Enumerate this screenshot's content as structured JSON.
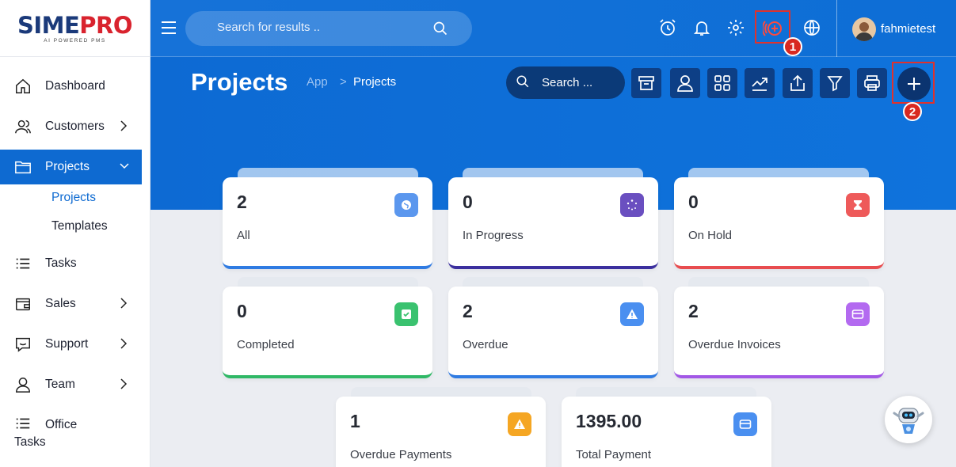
{
  "brand": {
    "name_part1": "SIME",
    "name_part2": "PRO",
    "tagline": "AI POWERED PMS"
  },
  "topbar": {
    "search_placeholder": "Search for results ..",
    "username": "fahmietest",
    "icons": [
      "alarm-clock-icon",
      "bell-icon",
      "gear-icon",
      "timer-add-icon",
      "globe-icon"
    ],
    "markers": [
      "1",
      "2"
    ]
  },
  "sidebar": {
    "items": [
      {
        "label": "Dashboard",
        "icon": "home-icon"
      },
      {
        "label": "Customers",
        "icon": "users-icon"
      },
      {
        "label": "Projects",
        "icon": "folder-icon"
      },
      {
        "label": "Tasks",
        "icon": "list-icon"
      },
      {
        "label": "Sales",
        "icon": "wallet-icon"
      },
      {
        "label": "Support",
        "icon": "chat-icon"
      },
      {
        "label": "Team",
        "icon": "user-icon"
      },
      {
        "label": "Office",
        "label2": "Tasks",
        "icon": "list-icon"
      }
    ],
    "sub_items": [
      {
        "label": "Projects"
      },
      {
        "label": "Templates"
      }
    ]
  },
  "page": {
    "title": "Projects",
    "breadcrumb": {
      "root": "App",
      "separator": ">",
      "current": "Projects"
    },
    "toolbar_search_label": "Search ...",
    "toolbar_buttons": [
      "archive-icon",
      "user-icon",
      "grid-icon",
      "chart-icon",
      "upload-icon",
      "filter-icon",
      "print-icon",
      "plus-icon"
    ]
  },
  "stats": [
    {
      "value": "2",
      "label": "All",
      "color": "#2f7be2",
      "icon_bg": "#5b97ee"
    },
    {
      "value": "0",
      "label": "In Progress",
      "color": "#3b2f9e",
      "icon_bg": "#6a4fc0"
    },
    {
      "value": "0",
      "label": "On Hold",
      "color": "#e84c4f",
      "icon_bg": "#ee5a5a"
    },
    {
      "value": "0",
      "label": "Completed",
      "color": "#2fb866",
      "icon_bg": "#3ac26f"
    },
    {
      "value": "2",
      "label": "Overdue",
      "color": "#2f7be2",
      "icon_bg": "#4a8ff0"
    },
    {
      "value": "2",
      "label": "Overdue Invoices",
      "color": "#a257e6",
      "icon_bg": "#b36af0"
    },
    {
      "value": "1",
      "label": "Overdue Payments",
      "color": "#f2a93b",
      "icon_bg": "#f5a623"
    },
    {
      "value": "1395.00",
      "label": "Total Payment",
      "color": "#2f7be2",
      "icon_bg": "#4a8ff0"
    }
  ],
  "colors": {
    "primary": "#0e6ad1",
    "highlight": "#e0322c",
    "dark_button": "#0d3f86"
  }
}
